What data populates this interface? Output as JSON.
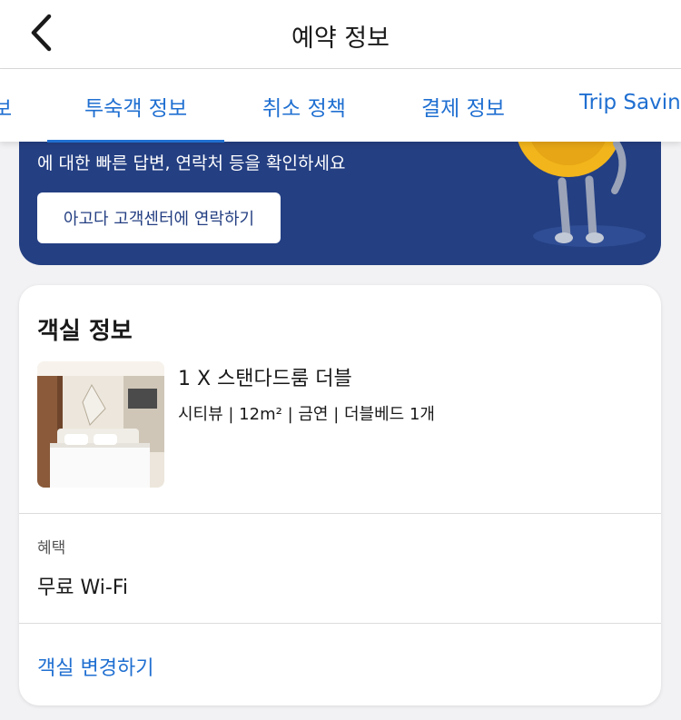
{
  "header": {
    "title": "예약 정보"
  },
  "tabs": [
    {
      "label": "보"
    },
    {
      "label": "투숙객 정보"
    },
    {
      "label": "취소 정책"
    },
    {
      "label": "결제 정보"
    },
    {
      "label": "Trip Saving"
    }
  ],
  "banner": {
    "text": "에 대한 빠른 답변, 연락처 등을 확인하세요",
    "button_label": "아고다 고객센터에 연락하기"
  },
  "room_card": {
    "title": "객실 정보",
    "room_name": "1 X 스탠다드룸 더블",
    "room_details": "시티뷰 | 12m² | 금연 | 더블베드 1개",
    "benefit_label": "혜택",
    "benefit_value": "무료 Wi-Fi",
    "change_link": "객실 변경하기"
  },
  "colors": {
    "accent": "#1f6fd1",
    "banner": "#243f82",
    "background": "#f2f2f4"
  },
  "icons": {
    "back": "chevron-left-icon",
    "mascot": "mascot-illustration"
  }
}
